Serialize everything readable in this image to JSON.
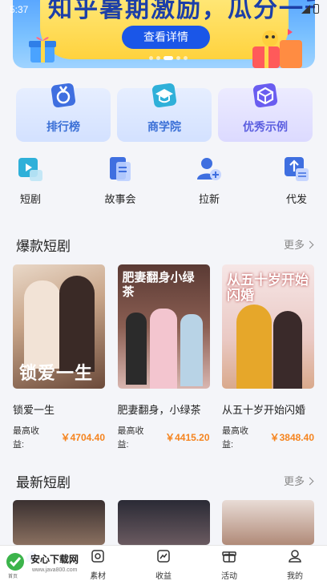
{
  "status_bar": {
    "time": "5:37"
  },
  "banner": {
    "headline": "知乎暑期激励，瓜分一千亿",
    "button_label": "查看详情"
  },
  "top_cards": [
    {
      "label": "排行榜",
      "icon": "medal-icon"
    },
    {
      "label": "商学院",
      "icon": "graduation-cap-icon"
    },
    {
      "label": "优秀示例",
      "icon": "cube-icon"
    }
  ],
  "quick_actions": [
    {
      "label": "短剧",
      "icon": "play-video-icon"
    },
    {
      "label": "故事会",
      "icon": "book-icon"
    },
    {
      "label": "拉新",
      "icon": "add-user-icon"
    },
    {
      "label": "代发",
      "icon": "upload-swap-icon"
    }
  ],
  "sections": {
    "hot": {
      "title": "爆款短剧",
      "more": "更多",
      "items": [
        {
          "title": "锁爱一生",
          "earn_label": "最高收益:",
          "earn_value": "￥4704.40",
          "poster_text": "锁爱一生"
        },
        {
          "title": "肥妻翻身，小绿茶",
          "earn_label": "最高收益:",
          "earn_value": "￥4415.20",
          "poster_text": "肥妻翻身小绿茶"
        },
        {
          "title": "从五十岁开始闪婚",
          "earn_label": "最高收益:",
          "earn_value": "￥3848.40",
          "poster_text": "从五十岁开始闪婚"
        }
      ]
    },
    "new": {
      "title": "最新短剧",
      "more": "更多"
    }
  },
  "bottom_nav": [
    {
      "label": "首页",
      "icon": "home-icon"
    },
    {
      "label": "素材",
      "icon": "material-icon"
    },
    {
      "label": "收益",
      "icon": "chart-icon"
    },
    {
      "label": "活动",
      "icon": "gift-icon"
    },
    {
      "label": "我的",
      "icon": "user-icon"
    }
  ],
  "watermark": {
    "name": "安心下载网",
    "url": "www.java800.com",
    "sub": "首页"
  },
  "colors": {
    "accent": "#1a56e8",
    "earn": "#f5841f",
    "banner_yellow": "#ffd23d"
  }
}
